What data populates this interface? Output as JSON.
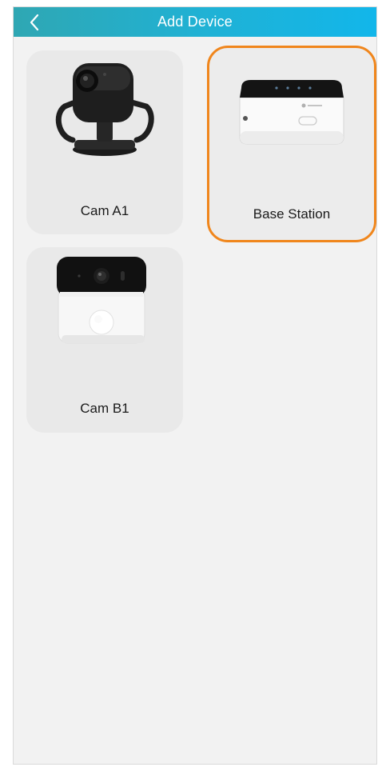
{
  "header": {
    "title": "Add Device",
    "back_icon": "chevron-left-icon",
    "gradient_start": "#2fa7b3",
    "gradient_end": "#12b6ea"
  },
  "devices": [
    {
      "label": "Cam A1",
      "icon": "ptz-camera-icon",
      "selected": false
    },
    {
      "label": "Base Station",
      "icon": "base-station-icon",
      "selected": true
    },
    {
      "label": "Cam B1",
      "icon": "battery-camera-icon",
      "selected": false
    }
  ],
  "colors": {
    "selected_border": "#f0861c",
    "card_background": "#e9e9e9",
    "page_background": "#f2f2f2"
  }
}
